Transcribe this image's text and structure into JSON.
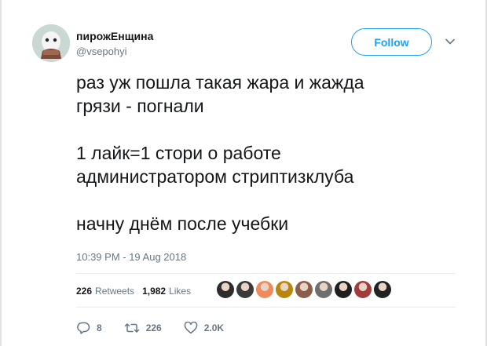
{
  "tweet": {
    "user": {
      "display_name": "пирожЕнщина",
      "handle": "@vsepohyi"
    },
    "follow_label": "Follow",
    "text_paragraphs": [
      "раз уж пошла такая жара и жажда\nгрязи - погнали",
      "1 лайк=1 стори о работе\nадминистратором стриптизклуба",
      "начну днём после учебки"
    ],
    "timestamp": "10:39 PM - 19 Aug 2018",
    "stats": {
      "retweets_count": "226",
      "retweets_label": "Retweets",
      "likes_count": "1,982",
      "likes_label": "Likes"
    },
    "likers": [
      {
        "icon": "liker-avatar-1",
        "color": "#2c2c2c"
      },
      {
        "icon": "liker-avatar-2",
        "color": "#3a3a3a"
      },
      {
        "icon": "liker-avatar-3",
        "color": "#f08a5d"
      },
      {
        "icon": "liker-avatar-4",
        "color": "#b8860b"
      },
      {
        "icon": "liker-avatar-5",
        "color": "#8b5e4a"
      },
      {
        "icon": "liker-avatar-6",
        "color": "#6e6e6e"
      },
      {
        "icon": "liker-avatar-7",
        "color": "#1f1f1f"
      },
      {
        "icon": "liker-avatar-8",
        "color": "#a33b3b"
      },
      {
        "icon": "liker-avatar-9",
        "color": "#222222"
      }
    ],
    "actions": {
      "replies": "8",
      "retweets": "226",
      "likes": "2.0K"
    }
  },
  "colors": {
    "accent": "#1da1f2",
    "secondary_text": "#657786",
    "primary_text": "#14171a"
  }
}
